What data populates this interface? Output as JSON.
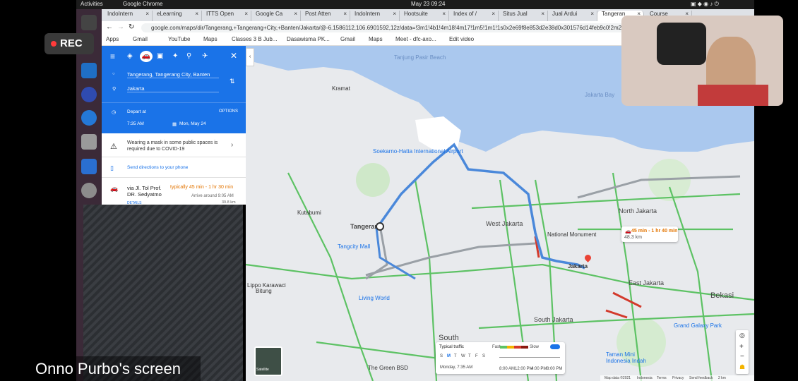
{
  "overlay": {
    "rec_label": "REC",
    "share_name": "Onno Purbo's screen"
  },
  "topbar": {
    "activities": "Activities",
    "app": "Google Chrome",
    "datetime": "May 23  09:24"
  },
  "tabs": [
    {
      "label": "IndoIntern"
    },
    {
      "label": "eLearning"
    },
    {
      "label": "ITTS Open"
    },
    {
      "label": "Google Ca"
    },
    {
      "label": "Post Atten"
    },
    {
      "label": "IndoIntern"
    },
    {
      "label": "Hootsuite"
    },
    {
      "label": "Index of /"
    },
    {
      "label": "Situs Jual"
    },
    {
      "label": "Jual Ardui"
    },
    {
      "label": "Tangeran"
    },
    {
      "label": "Course"
    }
  ],
  "url": "google.com/maps/dir/Tangerang,+Tangerang+City,+Banten/Jakarta/@-6.1586112,106.6901592,12z/data=!3m1!4b1!4m18!4m17!1m5!1m1!1s0x2e69f8e853d2e38d0x301576d14feb9c0!2m2!1d106.6403236!2d-6",
  "bookmarks": [
    "Apps",
    "Gmail",
    "YouTube",
    "Maps",
    "Classes 3 B Jub...",
    "Dasawisma PK...",
    "Gmail",
    "Maps",
    "Meet - dfc-axo...",
    "Edit video"
  ],
  "directions": {
    "origin": "Tangerang, Tangerang City, Banten",
    "destination": "Jakarta",
    "depart_at": "Depart at",
    "options": "OPTIONS",
    "time": "7:35 AM",
    "date": "Mon, May 24",
    "mask_notice": "Wearing a mask in some public spaces is required due to COVID-19",
    "send_to_phone": "Send directions to your phone",
    "route_via": "via Jl. Tol Prof. DR. Sedyatmo",
    "route_time": "typically 45 min - 1 hr 30 min",
    "route_arrive": "Arrive around 9:05 AM",
    "route_details": "DETAILS",
    "route_distance": "39.8 km"
  },
  "map_labels": {
    "tanjung_pasir": "Tanjung Pasir Beach",
    "kramat": "Kramat",
    "airport": "Soekarno-Hatta International Airport",
    "kutabumi": "Kutabumi",
    "tangerang": "Tangerang",
    "tangcity": "Tangcity Mall",
    "west_jakarta": "West Jakarta",
    "north_jakarta": "North Jakarta",
    "national_monument": "National Monument",
    "jakarta": "Jakarta",
    "east_jakarta": "East Jakarta",
    "bekasi": "Bekasi",
    "south_jakarta": "South Jakarta",
    "grand_galaxy": "Grand Galaxy Park",
    "lippo": "Lippo Karawaci",
    "lw": "Living World",
    "south": "South",
    "taman_mini": "Taman Mini Indonesia Indah",
    "jakarta_bay": "Jakarta Bay",
    "green_bsd": "The Green BSD",
    "bitung": "Bitung"
  },
  "route_badge": {
    "time": "45 min - 1 hr 40 min",
    "distance": "48.3 km"
  },
  "satellite_label": "Satellite",
  "traffic": {
    "label": "Typical traffic",
    "fast": "Fast",
    "slow": "Slow",
    "days": [
      "S",
      "M",
      "T",
      "W",
      "T",
      "F",
      "S"
    ],
    "when": "Monday, 7:35 AM",
    "times": [
      "8:00 AM",
      "12:00 PM",
      "4:00 PM",
      "8:00 PM"
    ]
  },
  "footer": [
    "Map data ©2021",
    "Indonesia",
    "Terms",
    "Privacy",
    "Send feedback",
    "2 km"
  ],
  "colors": {
    "blue": "#1a73e8",
    "traffic_green": "#5dc264",
    "traffic_red": "#d33a2c",
    "route_blue": "#4a88da"
  }
}
